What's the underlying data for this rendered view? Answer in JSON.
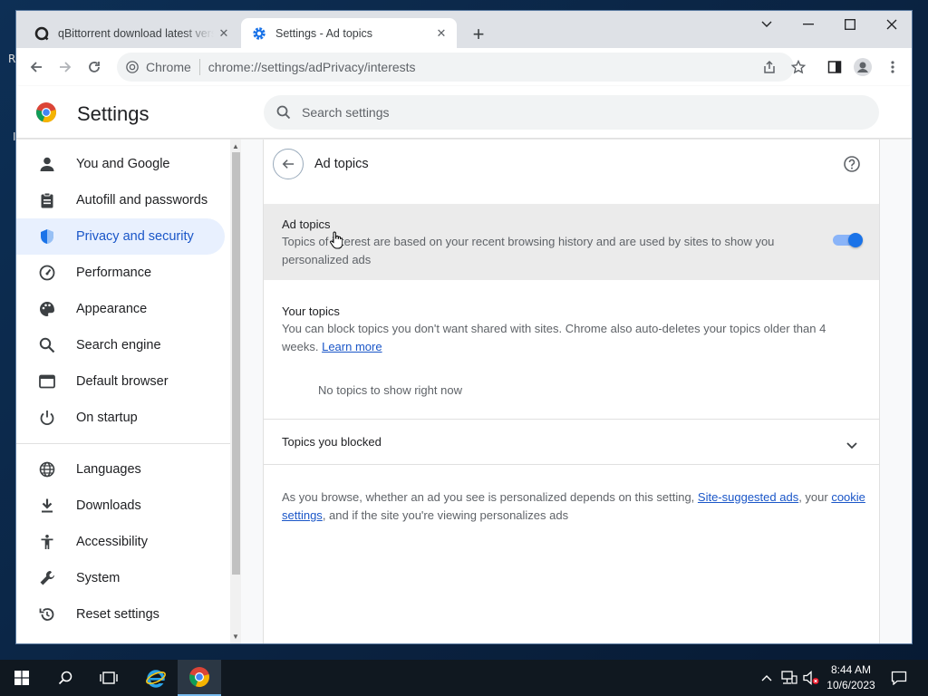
{
  "desktop": {
    "edge_char_top": "R",
    "edge_char_bottom": "I"
  },
  "tabs": [
    {
      "title": "qBittorrent download latest vers",
      "close": "✕"
    },
    {
      "title": "Settings - Ad topics",
      "close": "✕"
    }
  ],
  "toolbar": {
    "site_chip": "Chrome",
    "url": "chrome://settings/adPrivacy/interests"
  },
  "settings": {
    "title": "Settings",
    "search_placeholder": "Search settings"
  },
  "sidebar": {
    "items": [
      {
        "label": "You and Google",
        "icon": "person-icon"
      },
      {
        "label": "Autofill and passwords",
        "icon": "clipboard-icon"
      },
      {
        "label": "Privacy and security",
        "icon": "shield-icon",
        "active": true
      },
      {
        "label": "Performance",
        "icon": "gauge-icon"
      },
      {
        "label": "Appearance",
        "icon": "palette-icon"
      },
      {
        "label": "Search engine",
        "icon": "search-icon"
      },
      {
        "label": "Default browser",
        "icon": "browser-icon"
      },
      {
        "label": "On startup",
        "icon": "power-icon"
      },
      {
        "label": "Languages",
        "icon": "globe-icon"
      },
      {
        "label": "Downloads",
        "icon": "download-icon"
      },
      {
        "label": "Accessibility",
        "icon": "accessibility-icon"
      },
      {
        "label": "System",
        "icon": "wrench-icon"
      },
      {
        "label": "Reset settings",
        "icon": "reset-icon"
      }
    ]
  },
  "main": {
    "page_title": "Ad topics",
    "ad_topics_row": {
      "label": "Ad topics",
      "description": "Topics of interest are based on your recent browsing history and are used by sites to show you personalized ads",
      "toggle_on": true
    },
    "your_topics": {
      "label": "Your topics",
      "description": "You can block topics you don't want shared with sites. Chrome also auto-deletes your topics older than 4 weeks.",
      "learn_more": "Learn more",
      "empty": "No topics to show right now"
    },
    "blocked_row": {
      "label": "Topics you blocked"
    },
    "footer": {
      "text1": "As you browse, whether an ad you see is personalized depends on this setting, ",
      "link1": "Site-suggested ads",
      "text2": ", your ",
      "link2": "cookie settings",
      "text3": ", and if the site you're viewing personalizes ads"
    }
  },
  "taskbar": {
    "time": "8:44 AM",
    "date": "10/6/2023"
  },
  "colors": {
    "accent": "#1a73e8",
    "active_nav_bg": "#e8f0fe",
    "active_nav_text": "#1a56c8",
    "taskbar": "#101820"
  }
}
